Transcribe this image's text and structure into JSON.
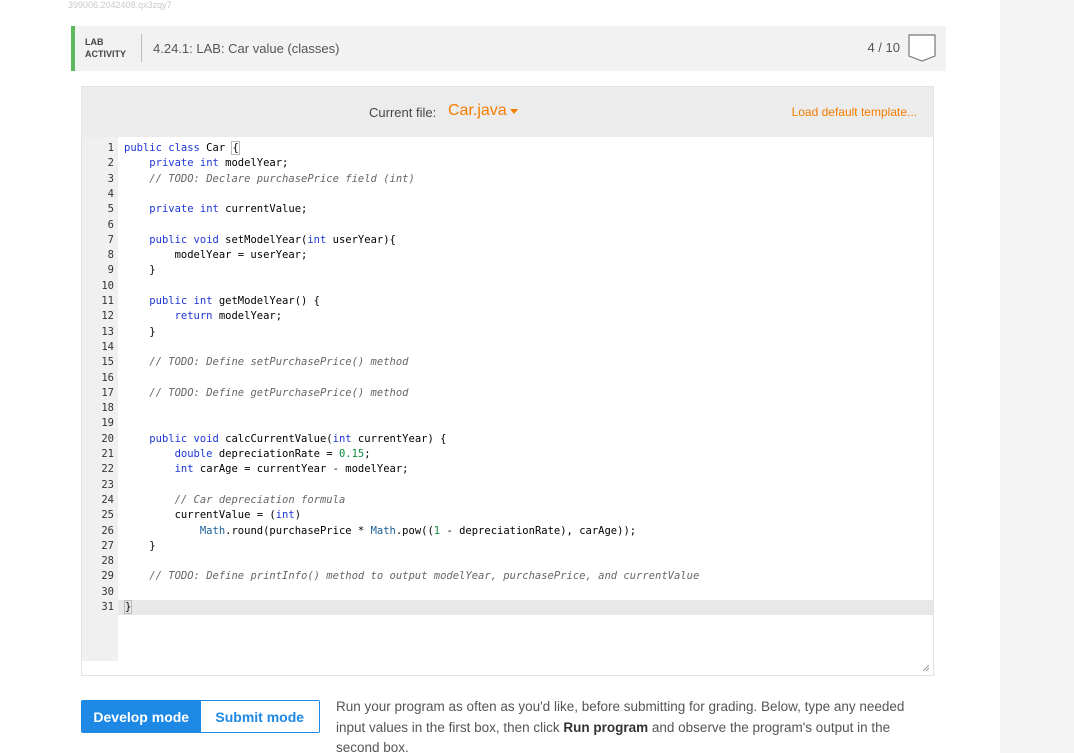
{
  "debug_id": "399006.2042408.qx3zqy7",
  "header": {
    "tag_line1": "LAB",
    "tag_line2": "ACTIVITY",
    "title": "4.24.1: LAB: Car value (classes)",
    "score": "4 / 10"
  },
  "editor": {
    "current_file_label": "Current file:",
    "current_file_name": "Car.java",
    "load_template": "Load default template...",
    "active_line": 31,
    "lines": [
      [
        {
          "t": "public class",
          "c": "kw"
        },
        {
          "t": " Car "
        },
        {
          "t": "{",
          "c": "bracket"
        }
      ],
      [
        {
          "t": "    "
        },
        {
          "t": "private int",
          "c": "kw"
        },
        {
          "t": " modelYear;"
        }
      ],
      [
        {
          "t": "    "
        },
        {
          "t": "// TODO: Declare purchasePrice field (int)",
          "c": "cm"
        }
      ],
      [],
      [
        {
          "t": "    "
        },
        {
          "t": "private int",
          "c": "kw"
        },
        {
          "t": " currentValue;"
        }
      ],
      [],
      [
        {
          "t": "    "
        },
        {
          "t": "public void",
          "c": "kw"
        },
        {
          "t": " setModelYear("
        },
        {
          "t": "int",
          "c": "kw"
        },
        {
          "t": " userYear){"
        }
      ],
      [
        {
          "t": "        modelYear = userYear;"
        }
      ],
      [
        {
          "t": "    }"
        }
      ],
      [],
      [
        {
          "t": "    "
        },
        {
          "t": "public int",
          "c": "kw"
        },
        {
          "t": " getModelYear() {"
        }
      ],
      [
        {
          "t": "        "
        },
        {
          "t": "return",
          "c": "kw"
        },
        {
          "t": " modelYear;"
        }
      ],
      [
        {
          "t": "    }"
        }
      ],
      [],
      [
        {
          "t": "    "
        },
        {
          "t": "// TODO: Define setPurchasePrice() method",
          "c": "cm"
        }
      ],
      [],
      [
        {
          "t": "    "
        },
        {
          "t": "// TODO: Define getPurchasePrice() method",
          "c": "cm"
        }
      ],
      [],
      [],
      [
        {
          "t": "    "
        },
        {
          "t": "public void",
          "c": "kw"
        },
        {
          "t": " calcCurrentValue("
        },
        {
          "t": "int",
          "c": "kw"
        },
        {
          "t": " currentYear) {"
        }
      ],
      [
        {
          "t": "        "
        },
        {
          "t": "double",
          "c": "kw"
        },
        {
          "t": " depreciationRate = "
        },
        {
          "t": "0.15",
          "c": "num"
        },
        {
          "t": ";"
        }
      ],
      [
        {
          "t": "        "
        },
        {
          "t": "int",
          "c": "kw"
        },
        {
          "t": " carAge = currentYear - modelYear;"
        }
      ],
      [],
      [
        {
          "t": "        "
        },
        {
          "t": "// Car depreciation formula",
          "c": "cm"
        }
      ],
      [
        {
          "t": "        currentValue = ("
        },
        {
          "t": "int",
          "c": "kw"
        },
        {
          "t": ")"
        }
      ],
      [
        {
          "t": "            "
        },
        {
          "t": "Math",
          "c": "cls"
        },
        {
          "t": ".round(purchasePrice * "
        },
        {
          "t": "Math",
          "c": "cls"
        },
        {
          "t": ".pow(("
        },
        {
          "t": "1",
          "c": "num"
        },
        {
          "t": " - depreciationRate), carAge));"
        }
      ],
      [
        {
          "t": "    }"
        }
      ],
      [],
      [
        {
          "t": "    "
        },
        {
          "t": "// TODO: Define printInfo() method to output modelYear, purchasePrice, and currentValue",
          "c": "cm"
        }
      ],
      [],
      [
        {
          "t": "}",
          "c": "bracket"
        }
      ]
    ]
  },
  "modes": {
    "develop": "Develop mode",
    "submit": "Submit mode"
  },
  "instructions": {
    "part1": "Run your program as often as you'd like, before submitting for grading. Below, type any needed input values in the first box, then click ",
    "bold": "Run program",
    "part2": " and observe the program's output in the second box."
  },
  "colors": {
    "accent_green": "#5cb85c",
    "accent_orange": "#f57c00",
    "accent_blue": "#1e88e5"
  }
}
